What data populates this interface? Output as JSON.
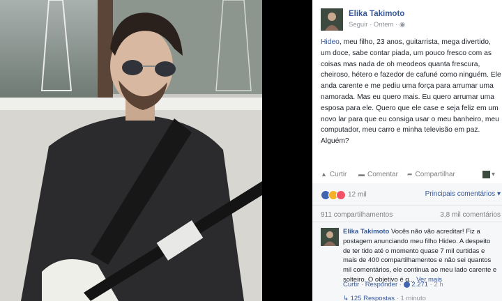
{
  "post": {
    "author": "Elika Takimoto",
    "follow_label": "Seguir",
    "time": "Ontem",
    "body_tag": "Hideo",
    "body_text": ", meu filho, 23 anos, guitarrista, mega divertido, um doce, sabe contar piada, um pouco fresco com as coisas mas nada de oh meodeos quanta frescura, cheiroso, hétero e fazedor de cafuné como ninguém. Ele anda carente e me pediu uma força para arrumar uma namorada. Mas eu quero mais. Eu quero arrumar uma esposa para ele. Quero que ele case e seja feliz em um novo lar para que eu consiga usar o meu banheiro, meu computador, meu carro e minha televisão em paz. Alguém?"
  },
  "actions": {
    "like": "Curtir",
    "comment": "Comentar",
    "share": "Compartilhar"
  },
  "reactions": {
    "count": "12 mil",
    "sort_label": "Principais comentários"
  },
  "stats": {
    "shares": "911 compartilhamentos",
    "comments": "3,8 mil comentários"
  },
  "comment": {
    "author": "Elika Takimoto",
    "text": "Vocês não vão acreditar! Fiz a postagem anunciando meu filho Hideo. A despeito de ter tido até o momento quase 7 mil curtidas e mais de 400 compartilhamentos e não sei quantos mil comentários, ele continua ao meu lado carente e solteiro. O objetivo é q...",
    "more": "Ver mais",
    "like": "Curtir",
    "reply": "Responder",
    "likes": "2.271",
    "time": "2 h",
    "replies": "125 Respostas",
    "replies_time": "1 minuto"
  },
  "colors": {
    "link": "#365899",
    "like_icon": "#4267b2",
    "haha_icon": "#f7b125",
    "love_icon": "#f25268"
  }
}
